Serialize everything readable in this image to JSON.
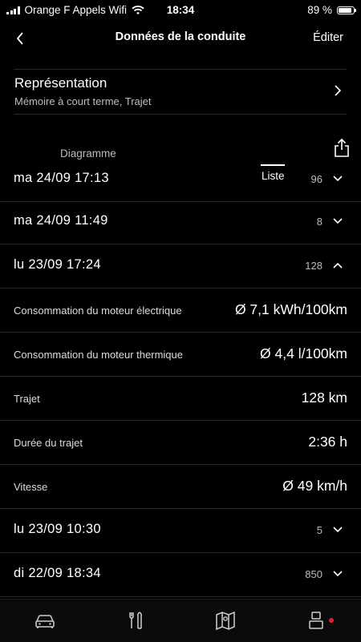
{
  "status_bar": {
    "carrier": "Orange F Appels Wifi",
    "time": "18:34",
    "battery": "89 %",
    "battery_level": 0.89
  },
  "nav": {
    "title": "Données de la conduite",
    "edit_label": "Éditer",
    "back_icon": "chevron-left-icon"
  },
  "representation": {
    "title": "Représentation",
    "subtitle": "Mémoire à court terme, Trajet"
  },
  "tabs": {
    "diagram": "Diagramme",
    "list": "Liste",
    "selected": "list"
  },
  "trips": [
    {
      "date": "ma 24/09 17:13",
      "count": "96",
      "expanded": false
    },
    {
      "date": "ma 24/09 11:49",
      "count": "8",
      "expanded": false
    },
    {
      "date": "lu 23/09 17:24",
      "count": "128",
      "expanded": true
    },
    {
      "date": "lu 23/09 10:30",
      "count": "5",
      "expanded": false
    },
    {
      "date": "di 22/09 18:34",
      "count": "850",
      "expanded": false
    }
  ],
  "trip_details": [
    {
      "label": "Consommation du moteur électrique",
      "value": "Ø 7,1 kWh/100km"
    },
    {
      "label": "Consommation du moteur thermique",
      "value": "Ø 4,4 l/100km"
    },
    {
      "label": "Trajet",
      "value": "128 km"
    },
    {
      "label": "Durée du trajet",
      "value": "2:36 h"
    },
    {
      "label": "Vitesse",
      "value": "Ø 49 km/h"
    }
  ],
  "tabbar": {
    "items": [
      "car-icon",
      "tools-icon",
      "map-icon",
      "profile-icon"
    ],
    "notification_color": "#e5202c"
  }
}
